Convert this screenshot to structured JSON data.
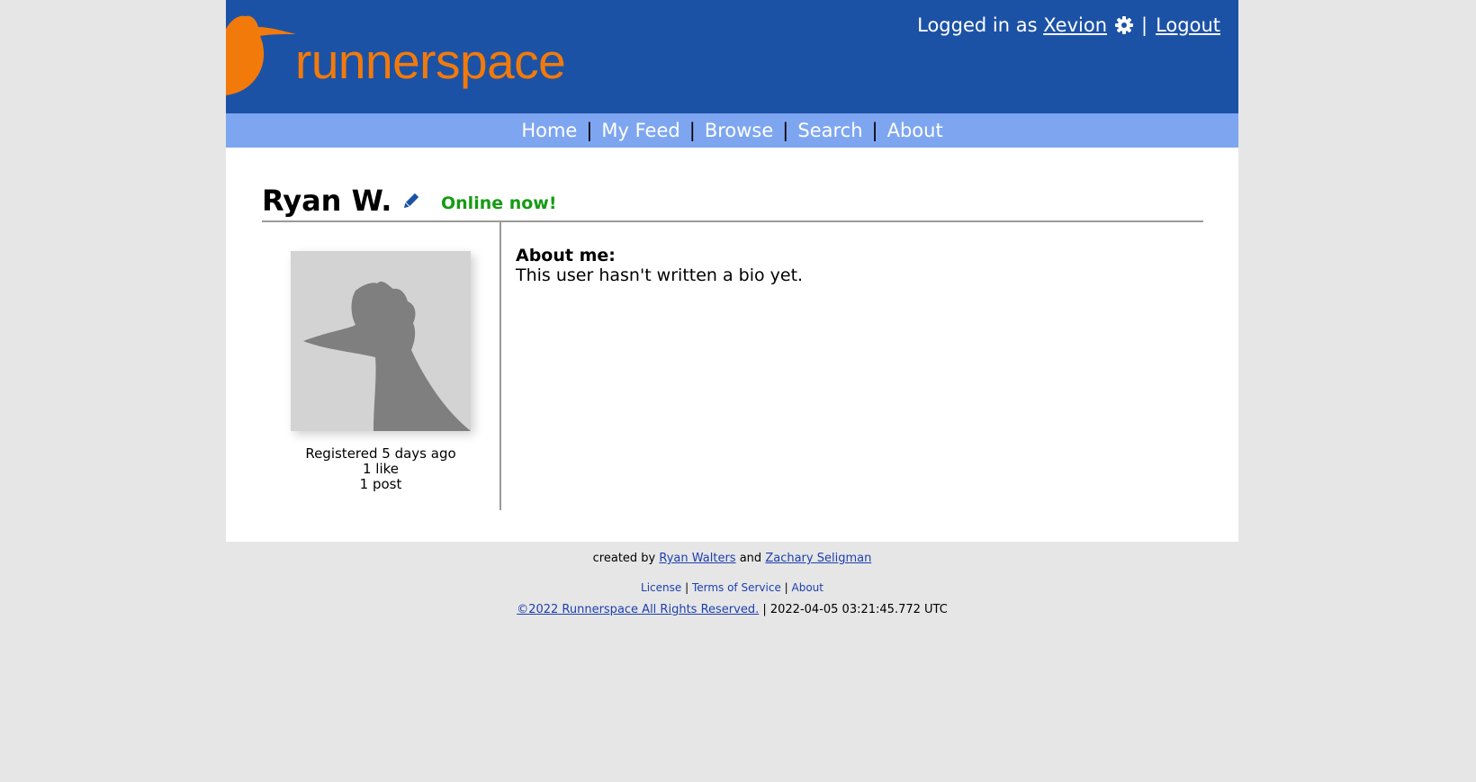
{
  "header": {
    "logo_text": "runnerspace",
    "logged_in_prefix": "Logged in as",
    "username": "Xevion",
    "separator": "|",
    "logout_label": "Logout"
  },
  "nav": {
    "items": [
      "Home",
      "My Feed",
      "Browse",
      "Search",
      "About"
    ],
    "separator": "|"
  },
  "profile": {
    "name": "Ryan W.",
    "status": "Online now!",
    "registered": "Registered 5 days ago",
    "likes": "1 like",
    "posts": "1 post",
    "about_label": "About me:",
    "bio": "This user hasn't written a bio yet."
  },
  "footer": {
    "created_by": "created by",
    "author1": "Ryan Walters",
    "and": "and",
    "author2": "Zachary Seligman",
    "links": [
      "License",
      "Terms of Service",
      "About"
    ],
    "copyright": "©2022 Runnerspace All Rights Reserved.",
    "timestamp": "| 2022-04-05 03:21:45.772 UTC"
  },
  "colors": {
    "header_bg": "#1c52a6",
    "nav_bg": "#7ea6f0",
    "brand_orange": "#f27a0a",
    "online_green": "#159b13",
    "link_blue": "#1c3fb0"
  },
  "icons": {
    "settings": "gear-icon",
    "edit": "pencil-icon",
    "logo": "roadrunner-icon"
  }
}
